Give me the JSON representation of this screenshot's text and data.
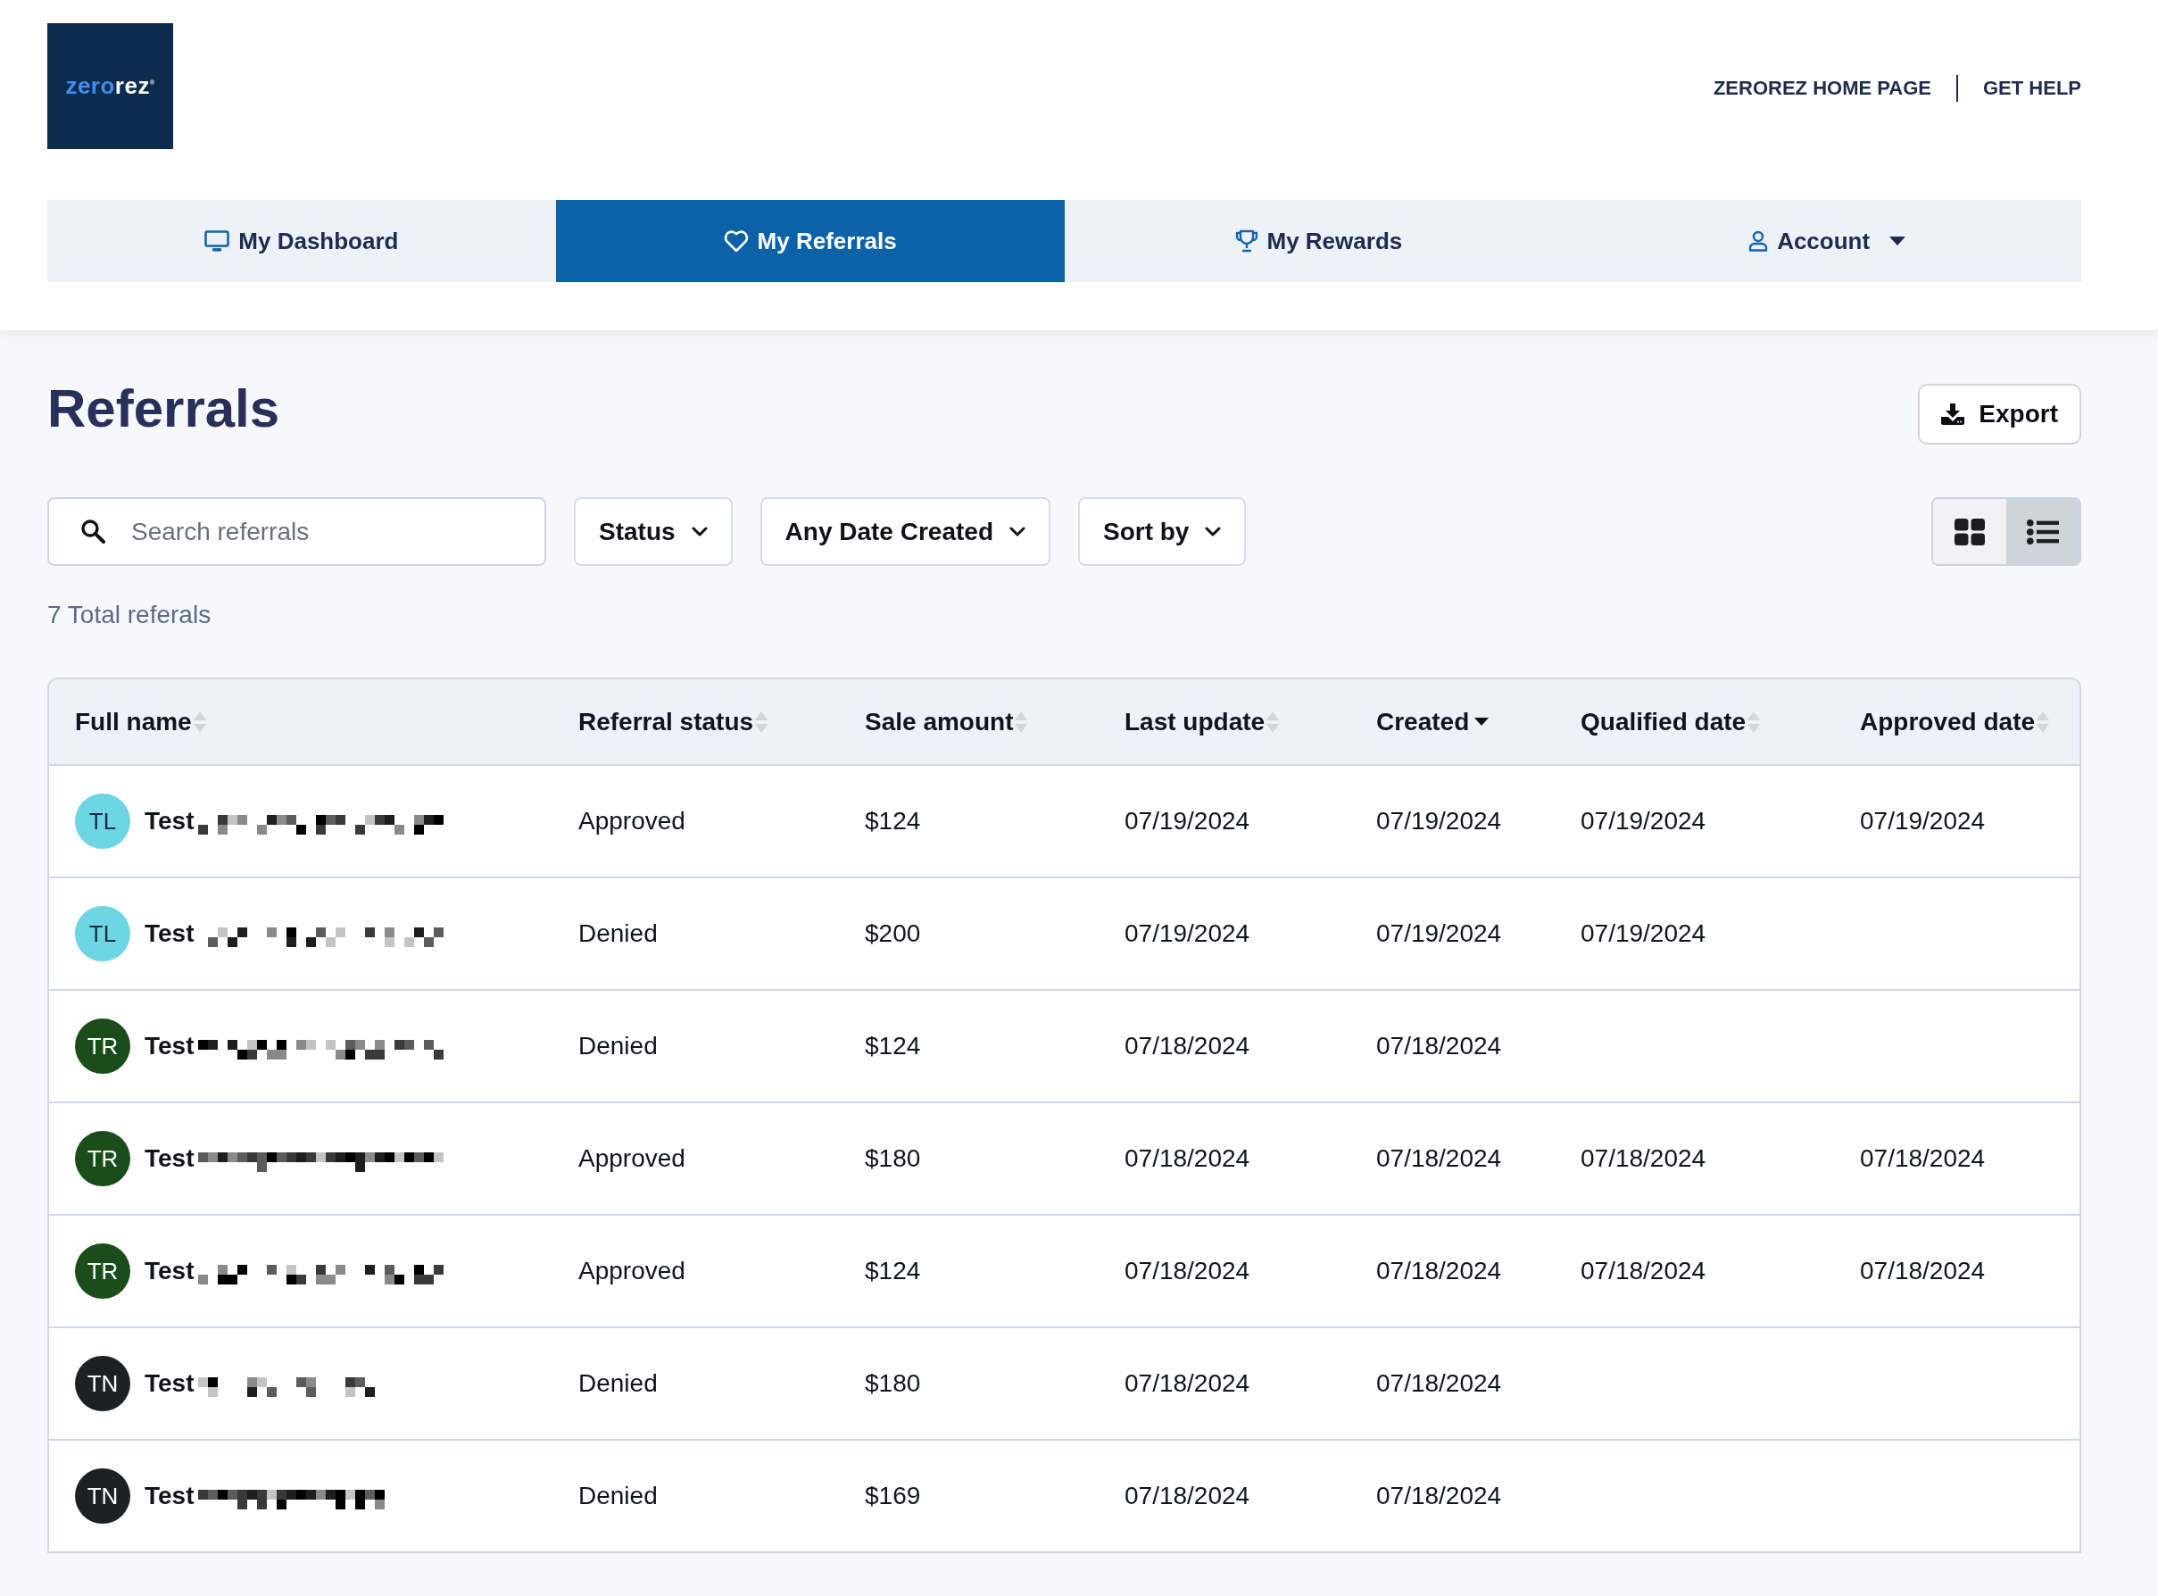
{
  "logo": {
    "parts": [
      {
        "text": "zero",
        "color": "#3d8ef0"
      },
      {
        "text": "rez",
        "color": "#ffffff"
      }
    ],
    "mark": "®"
  },
  "header_links": [
    "ZEROREZ HOME PAGE",
    "GET HELP"
  ],
  "tabs": [
    {
      "label": "My Dashboard",
      "kind": "dashboard",
      "selected": false
    },
    {
      "label": "My Referrals",
      "kind": "referrals",
      "selected": true
    },
    {
      "label": "My Rewards",
      "kind": "rewards",
      "selected": false
    },
    {
      "label": "Account",
      "kind": "account",
      "selected": false
    }
  ],
  "page": {
    "title": "Referrals",
    "export_button": "Export"
  },
  "search": {
    "placeholder": "Search referrals"
  },
  "filters": [
    {
      "label": "Status"
    },
    {
      "label": "Any Date Created"
    },
    {
      "label": "Sort by"
    }
  ],
  "view_toggle": [
    {
      "kind": "grid",
      "selected": false
    },
    {
      "kind": "list",
      "selected": true
    }
  ],
  "total_count": "7 Total referals",
  "table": {
    "columns": [
      {
        "label": "Full name",
        "sorted": false
      },
      {
        "label": "Referral status",
        "sorted": false
      },
      {
        "label": "Sale amount",
        "sorted": false
      },
      {
        "label": "Last update",
        "sorted": false
      },
      {
        "label": "Created",
        "sorted": true
      },
      {
        "label": "Qualified date",
        "sorted": false
      },
      {
        "label": "Approved date",
        "sorted": false
      }
    ],
    "rows": [
      {
        "initials": "TL",
        "color": "#6dd6e4",
        "name": "Test",
        "name_redacted": true,
        "referral_status": "Approved",
        "sale_amount": "$124",
        "last_update": "07/19/2024",
        "created": "07/19/2024",
        "qualified_date": "07/19/2024",
        "approved_date": "07/19/2024"
      },
      {
        "initials": "TL",
        "color": "#6dd6e4",
        "name": "Test",
        "name_redacted": true,
        "referral_status": "Denied",
        "sale_amount": "$200",
        "last_update": "07/19/2024",
        "created": "07/19/2024",
        "qualified_date": "07/19/2024"
      },
      {
        "initials": "TR",
        "color": "#1b4d1b",
        "name": "Test",
        "name_redacted": true,
        "referral_status": "Denied",
        "sale_amount": "$124",
        "last_update": "07/18/2024",
        "created": "07/18/2024"
      },
      {
        "initials": "TR",
        "color": "#1b4d1b",
        "name": "Test",
        "name_redacted": true,
        "referral_status": "Approved",
        "sale_amount": "$180",
        "last_update": "07/18/2024",
        "created": "07/18/2024",
        "qualified_date": "07/18/2024",
        "approved_date": "07/18/2024"
      },
      {
        "initials": "TR",
        "color": "#1b4d1b",
        "name": "Test",
        "name_redacted": true,
        "referral_status": "Approved",
        "sale_amount": "$124",
        "last_update": "07/18/2024",
        "created": "07/18/2024",
        "qualified_date": "07/18/2024",
        "approved_date": "07/18/2024"
      },
      {
        "initials": "TN",
        "color": "#1c2126",
        "name": "Test",
        "name_redacted": true,
        "referral_status": "Denied",
        "sale_amount": "$180",
        "last_update": "07/18/2024",
        "created": "07/18/2024"
      },
      {
        "initials": "TN",
        "color": "#1c2126",
        "name": "Test",
        "name_redacted": true,
        "referral_status": "Denied",
        "sale_amount": "$169",
        "last_update": "07/18/2024",
        "created": "07/18/2024"
      }
    ]
  }
}
